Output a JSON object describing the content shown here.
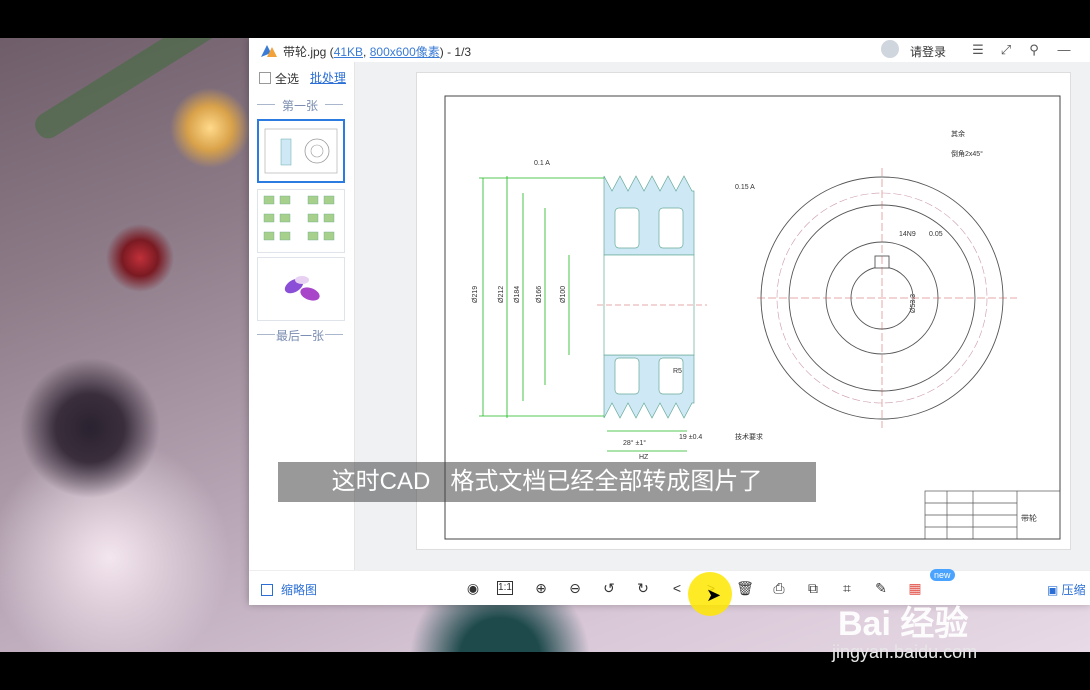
{
  "window": {
    "file_name": "带轮.jpg",
    "file_size": "41KB",
    "dimensions": "800x600像素",
    "page_counter": "1/3",
    "title_prefix": "带轮.jpg (",
    "title_sep": ", ",
    "title_suffix": ") - 1/3",
    "login_label": "请登录"
  },
  "sidebar": {
    "select_all": "全选",
    "batch": "批处理",
    "first_label": "第一张",
    "last_label": "最后一张"
  },
  "drawing": {
    "labels": [
      "0.1 A",
      "0.15 A",
      "其余",
      "倒角2x45°",
      "14N9",
      "0.05",
      "R5",
      "28° ±1°",
      "19 ±0.4",
      "技术要求",
      "带轮"
    ],
    "dims": [
      "Ø219",
      "Ø212",
      "Ø184",
      "Ø166",
      "Ø100",
      "Ø53.3",
      "HZ"
    ]
  },
  "subtitle": "这时CAD   格式文档已经全部转成图片了",
  "bottom": {
    "thumbnails_label": "缩略图",
    "new_badge": "new",
    "compress_label": "压缩"
  },
  "watermark": {
    "brand": "Bai 经验",
    "url": "jingyan.baidu.com"
  },
  "colors": {
    "accent": "#2b6fd6",
    "cad_green": "#1db81d",
    "cad_fill": "#cfe8f5"
  }
}
